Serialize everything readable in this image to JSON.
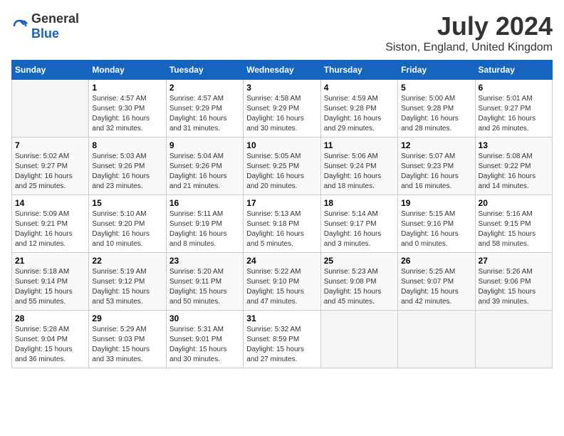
{
  "header": {
    "logo_general": "General",
    "logo_blue": "Blue",
    "month": "July 2024",
    "location": "Siston, England, United Kingdom"
  },
  "days_of_week": [
    "Sunday",
    "Monday",
    "Tuesday",
    "Wednesday",
    "Thursday",
    "Friday",
    "Saturday"
  ],
  "weeks": [
    [
      {
        "day": "",
        "info": ""
      },
      {
        "day": "1",
        "info": "Sunrise: 4:57 AM\nSunset: 9:30 PM\nDaylight: 16 hours\nand 32 minutes."
      },
      {
        "day": "2",
        "info": "Sunrise: 4:57 AM\nSunset: 9:29 PM\nDaylight: 16 hours\nand 31 minutes."
      },
      {
        "day": "3",
        "info": "Sunrise: 4:58 AM\nSunset: 9:29 PM\nDaylight: 16 hours\nand 30 minutes."
      },
      {
        "day": "4",
        "info": "Sunrise: 4:59 AM\nSunset: 9:28 PM\nDaylight: 16 hours\nand 29 minutes."
      },
      {
        "day": "5",
        "info": "Sunrise: 5:00 AM\nSunset: 9:28 PM\nDaylight: 16 hours\nand 28 minutes."
      },
      {
        "day": "6",
        "info": "Sunrise: 5:01 AM\nSunset: 9:27 PM\nDaylight: 16 hours\nand 26 minutes."
      }
    ],
    [
      {
        "day": "7",
        "info": "Sunrise: 5:02 AM\nSunset: 9:27 PM\nDaylight: 16 hours\nand 25 minutes."
      },
      {
        "day": "8",
        "info": "Sunrise: 5:03 AM\nSunset: 9:26 PM\nDaylight: 16 hours\nand 23 minutes."
      },
      {
        "day": "9",
        "info": "Sunrise: 5:04 AM\nSunset: 9:26 PM\nDaylight: 16 hours\nand 21 minutes."
      },
      {
        "day": "10",
        "info": "Sunrise: 5:05 AM\nSunset: 9:25 PM\nDaylight: 16 hours\nand 20 minutes."
      },
      {
        "day": "11",
        "info": "Sunrise: 5:06 AM\nSunset: 9:24 PM\nDaylight: 16 hours\nand 18 minutes."
      },
      {
        "day": "12",
        "info": "Sunrise: 5:07 AM\nSunset: 9:23 PM\nDaylight: 16 hours\nand 16 minutes."
      },
      {
        "day": "13",
        "info": "Sunrise: 5:08 AM\nSunset: 9:22 PM\nDaylight: 16 hours\nand 14 minutes."
      }
    ],
    [
      {
        "day": "14",
        "info": "Sunrise: 5:09 AM\nSunset: 9:21 PM\nDaylight: 16 hours\nand 12 minutes."
      },
      {
        "day": "15",
        "info": "Sunrise: 5:10 AM\nSunset: 9:20 PM\nDaylight: 16 hours\nand 10 minutes."
      },
      {
        "day": "16",
        "info": "Sunrise: 5:11 AM\nSunset: 9:19 PM\nDaylight: 16 hours\nand 8 minutes."
      },
      {
        "day": "17",
        "info": "Sunrise: 5:13 AM\nSunset: 9:18 PM\nDaylight: 16 hours\nand 5 minutes."
      },
      {
        "day": "18",
        "info": "Sunrise: 5:14 AM\nSunset: 9:17 PM\nDaylight: 16 hours\nand 3 minutes."
      },
      {
        "day": "19",
        "info": "Sunrise: 5:15 AM\nSunset: 9:16 PM\nDaylight: 16 hours\nand 0 minutes."
      },
      {
        "day": "20",
        "info": "Sunrise: 5:16 AM\nSunset: 9:15 PM\nDaylight: 15 hours\nand 58 minutes."
      }
    ],
    [
      {
        "day": "21",
        "info": "Sunrise: 5:18 AM\nSunset: 9:14 PM\nDaylight: 15 hours\nand 55 minutes."
      },
      {
        "day": "22",
        "info": "Sunrise: 5:19 AM\nSunset: 9:12 PM\nDaylight: 15 hours\nand 53 minutes."
      },
      {
        "day": "23",
        "info": "Sunrise: 5:20 AM\nSunset: 9:11 PM\nDaylight: 15 hours\nand 50 minutes."
      },
      {
        "day": "24",
        "info": "Sunrise: 5:22 AM\nSunset: 9:10 PM\nDaylight: 15 hours\nand 47 minutes."
      },
      {
        "day": "25",
        "info": "Sunrise: 5:23 AM\nSunset: 9:08 PM\nDaylight: 15 hours\nand 45 minutes."
      },
      {
        "day": "26",
        "info": "Sunrise: 5:25 AM\nSunset: 9:07 PM\nDaylight: 15 hours\nand 42 minutes."
      },
      {
        "day": "27",
        "info": "Sunrise: 5:26 AM\nSunset: 9:06 PM\nDaylight: 15 hours\nand 39 minutes."
      }
    ],
    [
      {
        "day": "28",
        "info": "Sunrise: 5:28 AM\nSunset: 9:04 PM\nDaylight: 15 hours\nand 36 minutes."
      },
      {
        "day": "29",
        "info": "Sunrise: 5:29 AM\nSunset: 9:03 PM\nDaylight: 15 hours\nand 33 minutes."
      },
      {
        "day": "30",
        "info": "Sunrise: 5:31 AM\nSunset: 9:01 PM\nDaylight: 15 hours\nand 30 minutes."
      },
      {
        "day": "31",
        "info": "Sunrise: 5:32 AM\nSunset: 8:59 PM\nDaylight: 15 hours\nand 27 minutes."
      },
      {
        "day": "",
        "info": ""
      },
      {
        "day": "",
        "info": ""
      },
      {
        "day": "",
        "info": ""
      }
    ]
  ]
}
